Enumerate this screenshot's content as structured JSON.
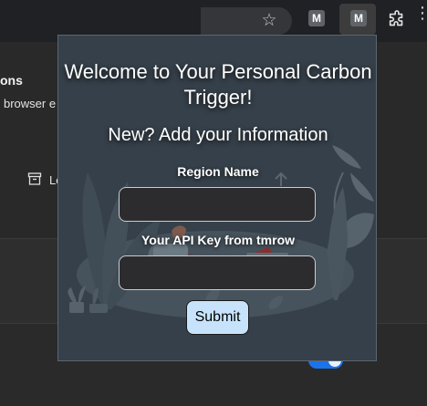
{
  "browser": {
    "star_icon": "star-icon",
    "extensions": [
      {
        "name": "extension-m-1",
        "label": "M"
      },
      {
        "name": "extension-m-2",
        "label": "M"
      }
    ],
    "puzzle_icon": "puzzle-icon"
  },
  "background_page": {
    "title_fragment": "ons",
    "subtitle_fragment": "browser e",
    "archive_label_fragment": "Lo",
    "toggle_color": "#1a73e8"
  },
  "popup": {
    "title": "Welcome to Your Personal Carbon Trigger!",
    "subtitle": "New? Add your Information",
    "region_label": "Region Name",
    "region_value": "",
    "api_label": "Your API Key from tmrow",
    "api_value": "",
    "submit_label": "Submit",
    "colors": {
      "background": "#36404a",
      "button": "#c7e3fb",
      "field": "#2c2c2e"
    }
  }
}
